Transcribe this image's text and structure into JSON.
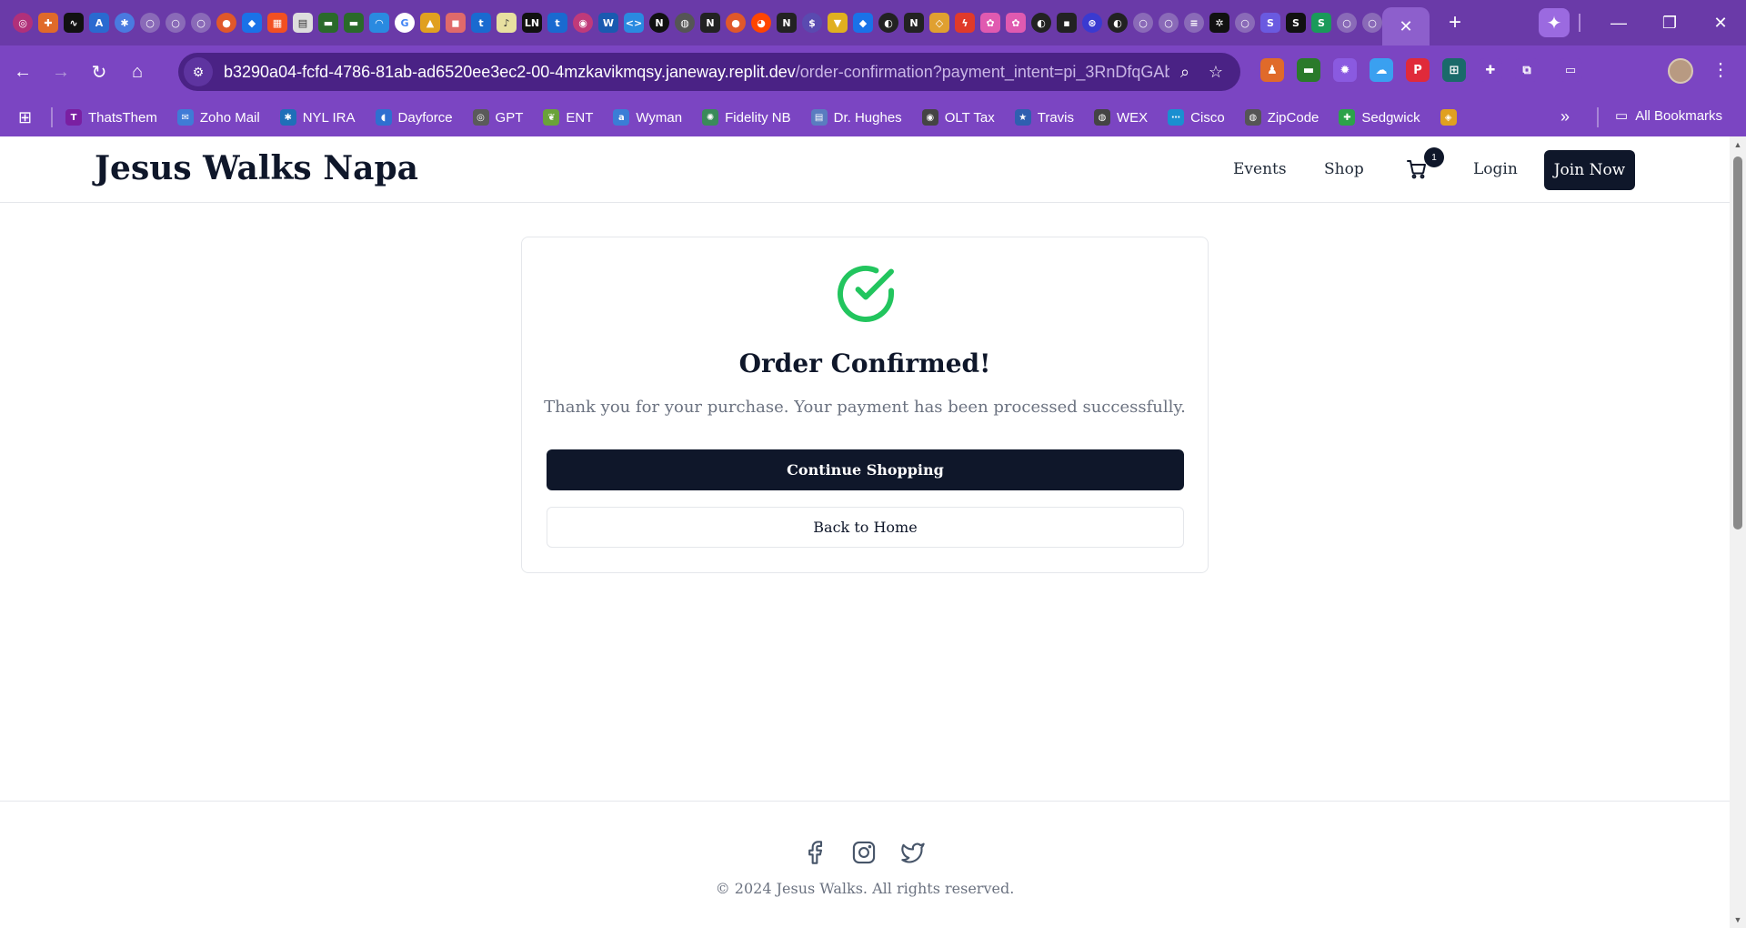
{
  "browser": {
    "url_host": "b3290a04-fcfd-4786-81ab-ad6520ee3ec2-00-4mzkavikmqsy.janeway.replit.dev",
    "url_path": "/order-confirmation?payment_intent=pi_3RnDfqGAb...",
    "accent": "#7b45c2",
    "bookmarks": [
      {
        "label": "ThatsThem",
        "color": "#7a1fa2"
      },
      {
        "label": "Zoho Mail",
        "color": "#3f7bd6"
      },
      {
        "label": "NYL IRA",
        "color": "#1f6fb8"
      },
      {
        "label": "Dayforce",
        "color": "#2f6fd0"
      },
      {
        "label": "GPT",
        "color": "#5a5a5a"
      },
      {
        "label": "ENT",
        "color": "#6aa23a"
      },
      {
        "label": "Wyman",
        "color": "#3a7dd6"
      },
      {
        "label": "Fidelity NB",
        "color": "#3a8a5a"
      },
      {
        "label": "Dr. Hughes",
        "color": "#5a7cc0"
      },
      {
        "label": "OLT Tax",
        "color": "#444444"
      },
      {
        "label": "Travis",
        "color": "#2f5fb0"
      },
      {
        "label": "WEX",
        "color": "#444444"
      },
      {
        "label": "Cisco",
        "color": "#1a8fd0"
      },
      {
        "label": "ZipCode",
        "color": "#555555"
      },
      {
        "label": "Sedgwick",
        "color": "#2ca24a"
      }
    ],
    "all_bookmarks_label": "All Bookmarks"
  },
  "site": {
    "brand": "Jesus Walks Napa",
    "nav": {
      "events": "Events",
      "shop": "Shop",
      "cart_count": "1",
      "login": "Login",
      "join": "Join Now"
    }
  },
  "confirmation": {
    "title": "Order Confirmed!",
    "message": "Thank you for your purchase. Your payment has been processed successfully.",
    "continue_label": "Continue Shopping",
    "home_label": "Back to Home",
    "success_color": "#22c55e"
  },
  "footer": {
    "copyright": "© 2024 Jesus Walks. All rights reserved."
  }
}
